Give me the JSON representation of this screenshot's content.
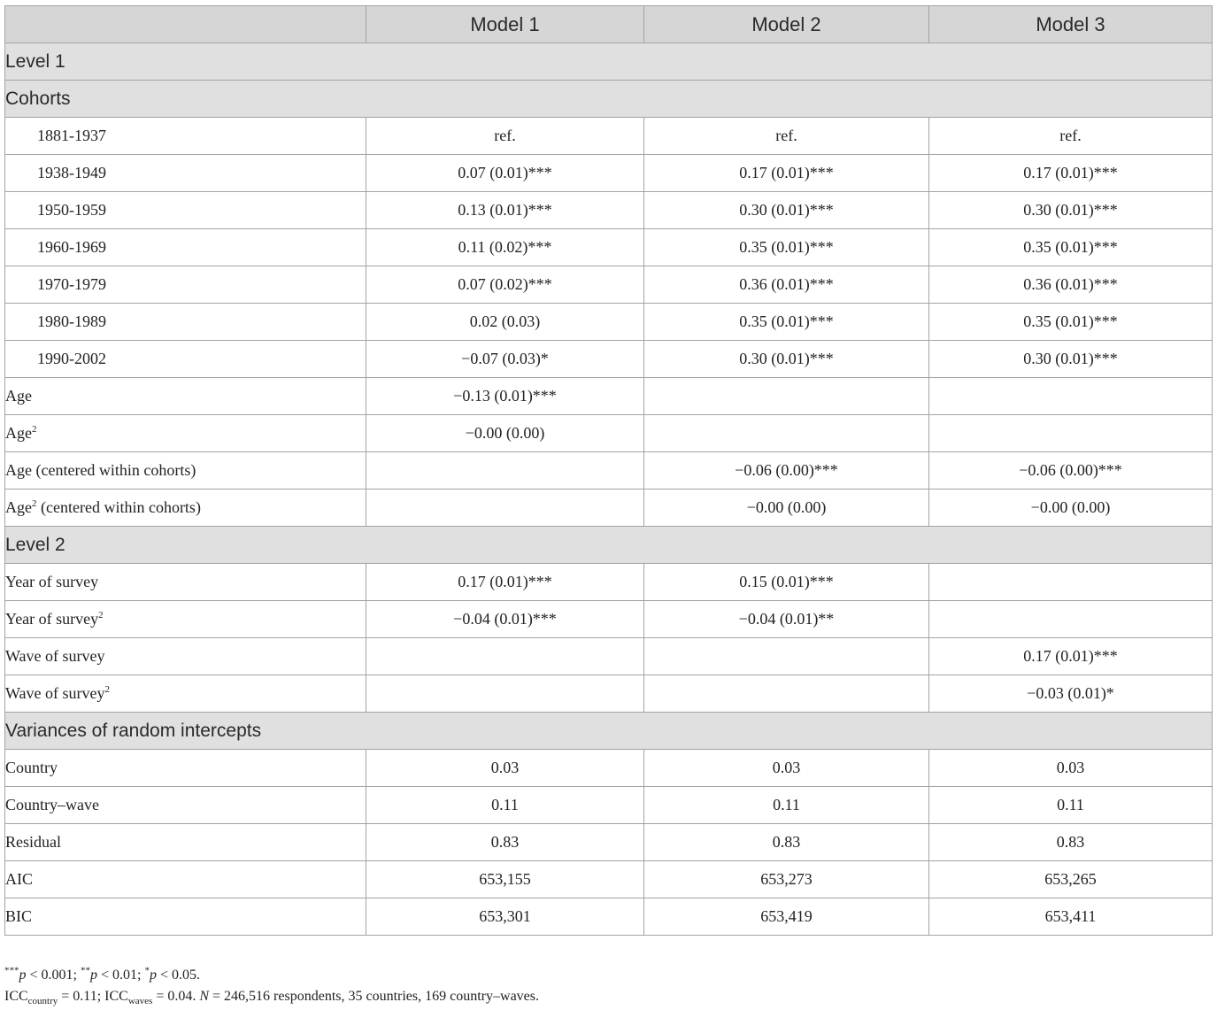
{
  "table": {
    "header": [
      "",
      "Model 1",
      "Model 2",
      "Model 3"
    ],
    "sections": {
      "level1": "Level 1",
      "cohorts": "Cohorts",
      "level2": "Level 2",
      "variances": "Variances of random intercepts"
    },
    "cohort_rows": [
      {
        "label": "1881-1937",
        "m1": "ref.",
        "m2": "ref.",
        "m3": "ref."
      },
      {
        "label": "1938-1949",
        "m1": "0.07 (0.01)***",
        "m2": "0.17 (0.01)***",
        "m3": "0.17 (0.01)***"
      },
      {
        "label": "1950-1959",
        "m1": "0.13 (0.01)***",
        "m2": "0.30 (0.01)***",
        "m3": "0.30 (0.01)***"
      },
      {
        "label": "1960-1969",
        "m1": "0.11 (0.02)***",
        "m2": "0.35 (0.01)***",
        "m3": "0.35 (0.01)***"
      },
      {
        "label": "1970-1979",
        "m1": "0.07 (0.02)***",
        "m2": "0.36 (0.01)***",
        "m3": "0.36 (0.01)***"
      },
      {
        "label": "1980-1989",
        "m1": "0.02 (0.03)",
        "m2": "0.35 (0.01)***",
        "m3": "0.35 (0.01)***"
      },
      {
        "label": "1990-2002",
        "m1": "−0.07 (0.03)*",
        "m2": "0.30 (0.01)***",
        "m3": "0.30 (0.01)***"
      }
    ],
    "age_rows": [
      {
        "label": "Age",
        "sup": "",
        "suffix": "",
        "m1": "−0.13 (0.01)***",
        "m2": "",
        "m3": ""
      },
      {
        "label": "Age",
        "sup": "2",
        "suffix": "",
        "m1": "−0.00 (0.00)",
        "m2": "",
        "m3": ""
      },
      {
        "label": "Age (centered within cohorts)",
        "sup": "",
        "suffix": "",
        "m1": "",
        "m2": "−0.06 (0.00)***",
        "m3": "−0.06 (0.00)***"
      },
      {
        "label": "Age",
        "sup": "2",
        "suffix": " (centered within cohorts)",
        "m1": "",
        "m2": "−0.00 (0.00)",
        "m3": "−0.00 (0.00)"
      }
    ],
    "level2_rows": [
      {
        "label": "Year of survey",
        "sup": "",
        "m1": "0.17 (0.01)***",
        "m2": "0.15 (0.01)***",
        "m3": ""
      },
      {
        "label": "Year of survey",
        "sup": "2",
        "m1": "−0.04 (0.01)***",
        "m2": "−0.04 (0.01)**",
        "m3": ""
      },
      {
        "label": "Wave of survey",
        "sup": "",
        "m1": "",
        "m2": "",
        "m3": "0.17 (0.01)***"
      },
      {
        "label": "Wave of survey",
        "sup": "2",
        "m1": "",
        "m2": "",
        "m3": "−0.03 (0.01)*"
      }
    ],
    "variance_rows": [
      {
        "label": "Country",
        "m1": "0.03",
        "m2": "0.03",
        "m3": "0.03"
      },
      {
        "label": "Country–wave",
        "m1": "0.11",
        "m2": "0.11",
        "m3": "0.11"
      },
      {
        "label": "Residual",
        "m1": "0.83",
        "m2": "0.83",
        "m3": "0.83"
      },
      {
        "label": "AIC",
        "m1": "653,155",
        "m2": "653,273",
        "m3": "653,265"
      },
      {
        "label": "BIC",
        "m1": "653,301",
        "m2": "653,419",
        "m3": "653,411"
      }
    ]
  },
  "footnotes": {
    "line1": {
      "s1": "***",
      "p1": "p",
      "t1": " < 0.001; ",
      "s2": "**",
      "p2": "p",
      "t2": " < 0.01; ",
      "s3": "*",
      "p3": "p",
      "t3": " < 0.05."
    },
    "line2": {
      "icc": "ICC",
      "sub1": "country",
      "t1": " = 0.11; ",
      "icc2": "ICC",
      "sub2": "waves",
      "t2": " = 0.04. ",
      "n": "N",
      "t3": " = 246,516 respondents, 35 countries, 169 country–waves."
    }
  }
}
